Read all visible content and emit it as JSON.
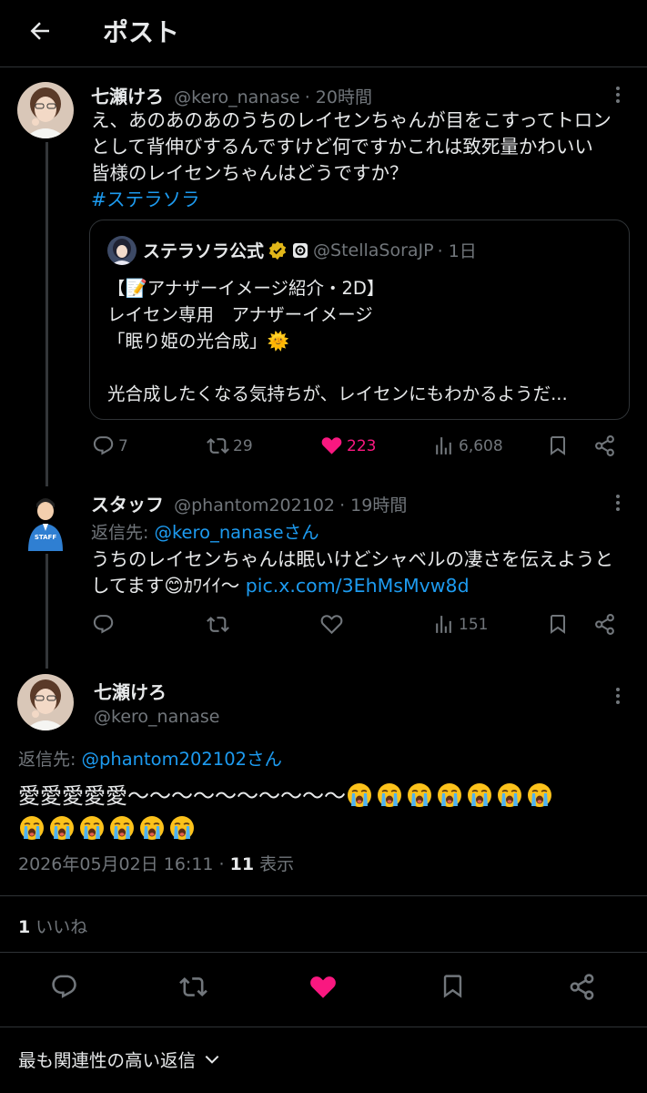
{
  "header": {
    "title": "ポスト"
  },
  "tweet1": {
    "name": "七瀬けろ",
    "handle": "@kero_nanase",
    "time": "· 20時間",
    "text_lines": [
      "え、あのあのあのうちのレイセンちゃんが目をこすってトロン",
      "として背伸びするんですけど何ですかこれは致死量かわいい",
      "皆様のレイセンちゃんはどうですか？"
    ],
    "hashtag": "#ステラソラ",
    "quote": {
      "name": "ステラソラ公式",
      "handle": "@StellaSoraJP",
      "time": "· 1日",
      "line1": "【📝アナザーイメージ紹介・2D】",
      "line2": "レイセン専用　アナザーイメージ",
      "line3": "「眠り姫の光合成」🌞",
      "line4": "光合成したくなる気持ちが、レイセンにもわかるようだ..."
    },
    "stats": {
      "replies": "7",
      "retweets": "29",
      "likes": "223",
      "views": "6,608"
    }
  },
  "tweet2": {
    "name": "スタッフ",
    "handle": "@phantom202102",
    "time": "· 19時間",
    "reply_prefix": "返信先: ",
    "reply_to": "@kero_nanaseさん",
    "text_line1": "うちのレイセンちゃんは眠いけどシャベルの凄さを伝えようと",
    "text_line2_a": "してます😊ｶﾜｲｲ〜 ",
    "text_line2_link": "pic.x.com/3EhMsMvw8d",
    "stats": {
      "views": "151"
    }
  },
  "main": {
    "name": "七瀬けろ",
    "handle": "@kero_nanase",
    "reply_prefix": "返信先: ",
    "reply_to": "@phantom202102さん",
    "text_line1": "愛愛愛愛愛〜〜〜〜〜〜〜〜〜〜",
    "emoji_line1_count": 7,
    "emoji_line2_count": 6,
    "date": "2026年05月02日 16:11 · ",
    "view_count": "11",
    "view_label": " 表示",
    "like_count": "1",
    "like_label": " いいね"
  },
  "footer": {
    "sort_label": "最も関連性の高い返信"
  },
  "colors": {
    "accent": "#1d9bf0",
    "like": "#f91880",
    "muted": "#71767b",
    "gold": "#e2b719"
  }
}
